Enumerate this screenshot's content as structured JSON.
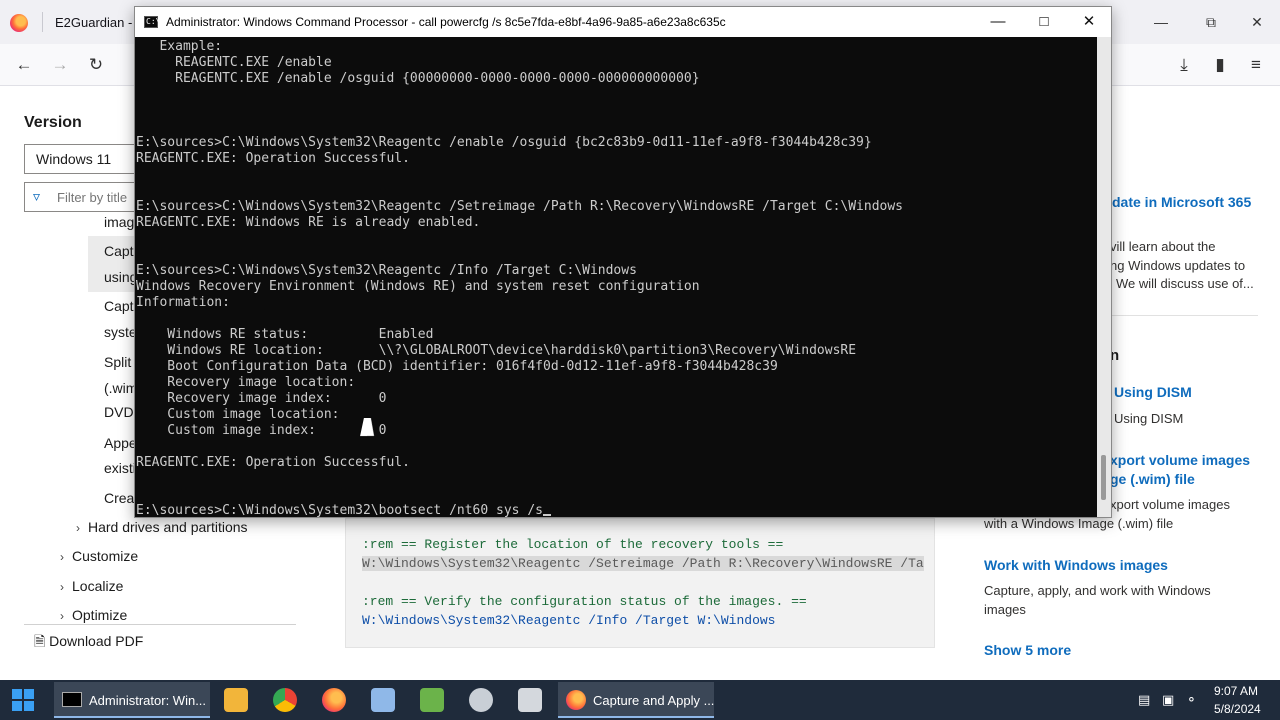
{
  "browser": {
    "tab_title": "E2Guardian - A",
    "nav_icons": [
      "back-icon",
      "forward-icon",
      "reload-icon",
      "download-icon",
      "extensions-icon",
      "menu-icon"
    ]
  },
  "docs": {
    "version_heading": "Version",
    "version_selected": "Windows 11",
    "filter_placeholder": "Filter by title",
    "toc": {
      "frag_imag": "imag",
      "frag_capt1": "Captu",
      "frag_using": "using",
      "frag_capt2": "Captu",
      "frag_syste": "syste",
      "frag_split": "Split",
      "frag_wim": "(.wim",
      "frag_dvds": "DVDs",
      "frag_appe": "Appe",
      "frag_existi": "existi",
      "frag_creat": "Creat",
      "hard_drives": "Hard drives and partitions",
      "customize": "Customize",
      "localize": "Localize",
      "optimize": "Optimize"
    },
    "download_pdf": "Download PDF",
    "code": {
      "line1": ":rem == Register the location of the recovery tools ==",
      "line2": "W:\\Windows\\System32\\Reagentc /Setreimage /Path R:\\Recovery\\WindowsRE /Ta",
      "line3": ":rem == Verify the configuration status of the images. ==",
      "line4": "W:\\Windows\\System32\\Reagentc /Info /Target W:\\Windows"
    },
    "rail": {
      "link1": "date in Microsoft 365",
      "text1a": "vill learn about the",
      "text1b": "ng Windows updates to",
      "text1c": "We will discuss use of...",
      "heading2": "n",
      "link2": "Using DISM",
      "text2": "Using DISM",
      "link3a": "xport volume images",
      "link3b": "ge (.wim) file",
      "text3a": "xport volume images",
      "text3b": "with a Windows Image (.wim) file",
      "link4": "Work with Windows images",
      "text4a": "Capture, apply, and work with Windows",
      "text4b": "images",
      "show_more": "Show 5 more"
    }
  },
  "console": {
    "title": "Administrator: Windows Command Processor - call  powercfg /s 8c5e7fda-e8bf-4a96-9a85-a6e23a8c635c",
    "lines": {
      "l01": "   Example:",
      "l02": "     REAGENTC.EXE /enable",
      "l03": "     REAGENTC.EXE /enable /osguid {00000000-0000-0000-0000-000000000000}",
      "l04": "E:\\sources>C:\\Windows\\System32\\Reagentc /enable /osguid {bc2c83b9-0d11-11ef-a9f8-f3044b428c39}",
      "l05": "REAGENTC.EXE: Operation Successful.",
      "l06": "E:\\sources>C:\\Windows\\System32\\Reagentc /Setreimage /Path R:\\Recovery\\WindowsRE /Target C:\\Windows",
      "l07": "REAGENTC.EXE: Windows RE is already enabled.",
      "l08": "E:\\sources>C:\\Windows\\System32\\Reagentc /Info /Target C:\\Windows",
      "l09": "Windows Recovery Environment (Windows RE) and system reset configuration",
      "l10": "Information:",
      "l11": "    Windows RE status:         Enabled",
      "l12": "    Windows RE location:       \\\\?\\GLOBALROOT\\device\\harddisk0\\partition3\\Recovery\\WindowsRE",
      "l13": "    Boot Configuration Data (BCD) identifier: 016f4f0d-0d12-11ef-a9f8-f3044b428c39",
      "l14": "    Recovery image location:",
      "l15": "    Recovery image index:      0",
      "l16": "    Custom image location:",
      "l17": "    Custom image index:        0",
      "l18": "REAGENTC.EXE: Operation Successful.",
      "l19": "E:\\sources>C:\\Windows\\System32\\bootsect /nt60 sys /s"
    }
  },
  "taskbar": {
    "cmd_task_label": "Administrator: Win...",
    "browser_task_label": "Capture and Apply ...",
    "time": "9:07 AM",
    "date": "5/8/2024"
  }
}
